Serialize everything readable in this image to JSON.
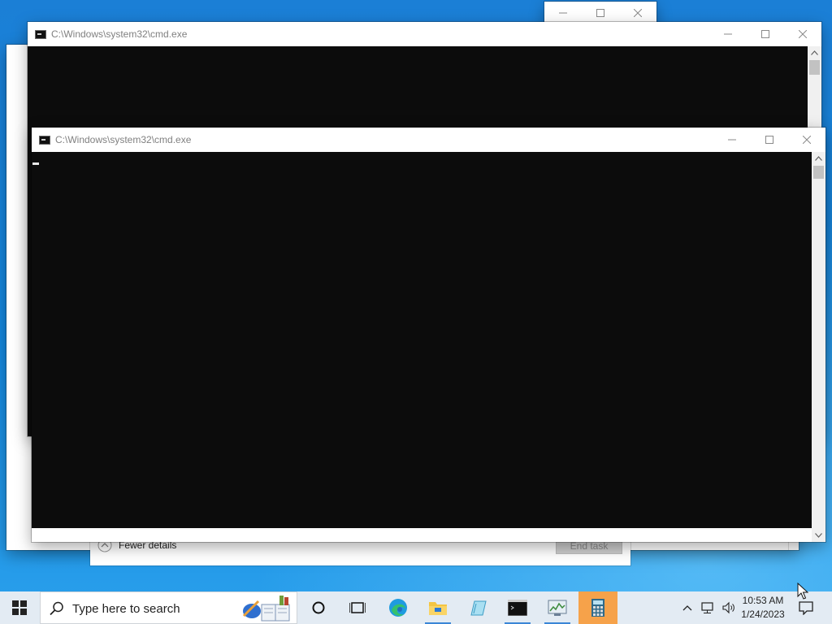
{
  "taskmgr": {
    "fewer_details": "Fewer details",
    "end_task": "End task"
  },
  "cmd_back": {
    "title": "C:\\Windows\\system32\\cmd.exe"
  },
  "cmd_front": {
    "title": "C:\\Windows\\system32\\cmd.exe"
  },
  "taskbar": {
    "search_placeholder": "Type here to search",
    "time": "10:53 AM",
    "date": "1/24/2023",
    "pinned_icons": [
      "cortana-icon",
      "task-view-icon",
      "edge-icon",
      "file-explorer-icon",
      "notepad-icon",
      "cmd-icon",
      "task-manager-icon",
      "calculator-icon"
    ],
    "tray_icons": [
      "chevron-up-icon",
      "network-icon",
      "volume-icon",
      "notification-icon"
    ]
  },
  "colors": {
    "console_bg": "#0c0c0c",
    "accent": "#3a86d6",
    "calculator_active": "#f6a24a"
  }
}
